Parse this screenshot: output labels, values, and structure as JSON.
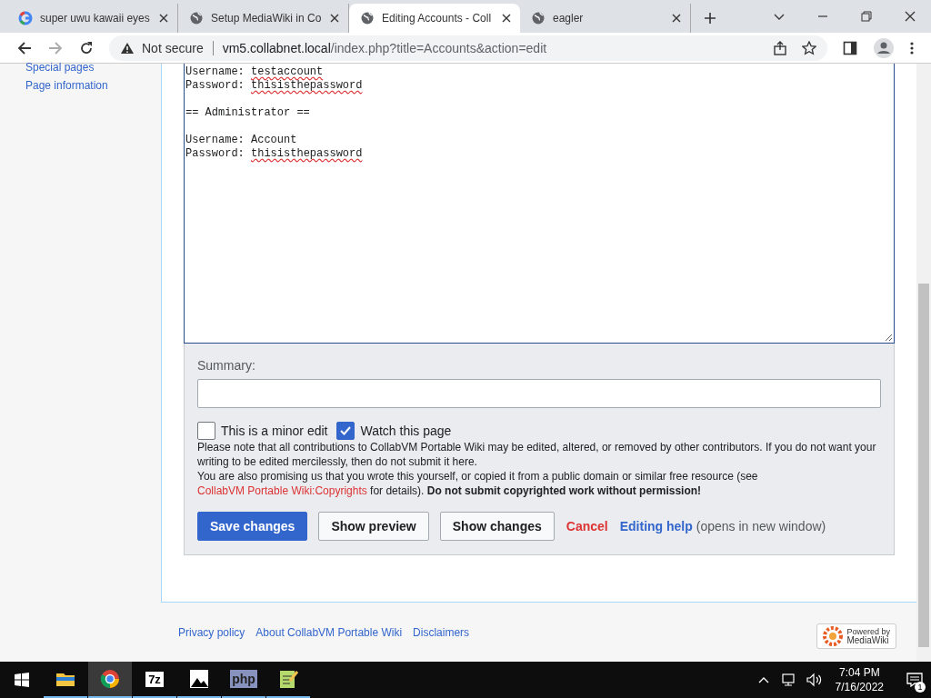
{
  "browser": {
    "tabs": [
      {
        "kind": "google",
        "title": "super uwu kawaii eyes",
        "selected": false
      },
      {
        "kind": "site",
        "title": "Setup MediaWiki in Co",
        "selected": false
      },
      {
        "kind": "site",
        "title": "Editing Accounts - Coll",
        "selected": true
      },
      {
        "kind": "site",
        "title": "eagler",
        "selected": false
      }
    ],
    "security": "Not secure",
    "url_host": "vm5.collabnet.local",
    "url_path": "/index.php?title=Accounts&action=edit"
  },
  "sidebar": {
    "items": [
      "Special pages",
      "Page information"
    ]
  },
  "editor": {
    "lines": [
      {
        "gap_before": false,
        "segments": [
          {
            "text": "Username: "
          },
          {
            "text": "testaccount",
            "misspelled": true
          }
        ]
      },
      {
        "gap_before": false,
        "segments": [
          {
            "text": "Password: "
          },
          {
            "text": "thisisthepassword",
            "misspelled": true
          }
        ]
      },
      {
        "gap_before": true,
        "segments": [
          {
            "text": "== Administrator =="
          }
        ]
      },
      {
        "gap_before": true,
        "segments": [
          {
            "text": "Username: Account"
          }
        ]
      },
      {
        "gap_before": false,
        "segments": [
          {
            "text": "Password: "
          },
          {
            "text": "thisisthepassword",
            "misspelled": true
          }
        ]
      }
    ]
  },
  "summary": {
    "label": "Summary:"
  },
  "checkboxes": [
    {
      "label": "This is a minor edit",
      "checked": false
    },
    {
      "label": "Watch this page",
      "checked": true
    }
  ],
  "notice": [
    [
      {
        "text": "Please note that all contributions to CollabVM Portable Wiki may be edited, altered, or removed by other contributors. If you do not want your writing to be edited mercilessly, then do not submit it here."
      }
    ],
    [
      {
        "text": "You are also promising us that you wrote this yourself, or copied it from a public domain or similar free resource (see "
      },
      {
        "text": "CollabVM Portable Wiki:Copyrights",
        "link": true
      },
      {
        "text": " for details). **Do not submit copyrighted work without permission!**"
      }
    ]
  ],
  "buttons": [
    {
      "label": "Save changes",
      "kind": "primary"
    },
    {
      "label": "Show preview",
      "kind": "normal"
    },
    {
      "label": "Show changes",
      "kind": "normal"
    }
  ],
  "cancel": "Cancel",
  "help": {
    "link": "Editing help",
    "note": "(opens in new window)"
  },
  "footer": {
    "links": [
      "Privacy policy",
      "About CollabVM Portable Wiki",
      "Disclaimers"
    ],
    "badge": [
      "Powered by",
      "MediaWiki"
    ]
  },
  "taskbar": {
    "apps": [
      {
        "kind": "folder",
        "running": true,
        "active": false
      },
      {
        "kind": "chrome",
        "running": true,
        "active": true
      },
      {
        "kind": "archive",
        "label": "7z",
        "running": true,
        "active": false
      },
      {
        "kind": "image",
        "running": true,
        "active": false
      },
      {
        "kind": "php",
        "label": "php",
        "running": true,
        "active": false
      },
      {
        "kind": "notepad",
        "running": true,
        "active": false
      }
    ],
    "time": "7:04 PM",
    "date": "7/16/2022",
    "notifications": "1"
  }
}
